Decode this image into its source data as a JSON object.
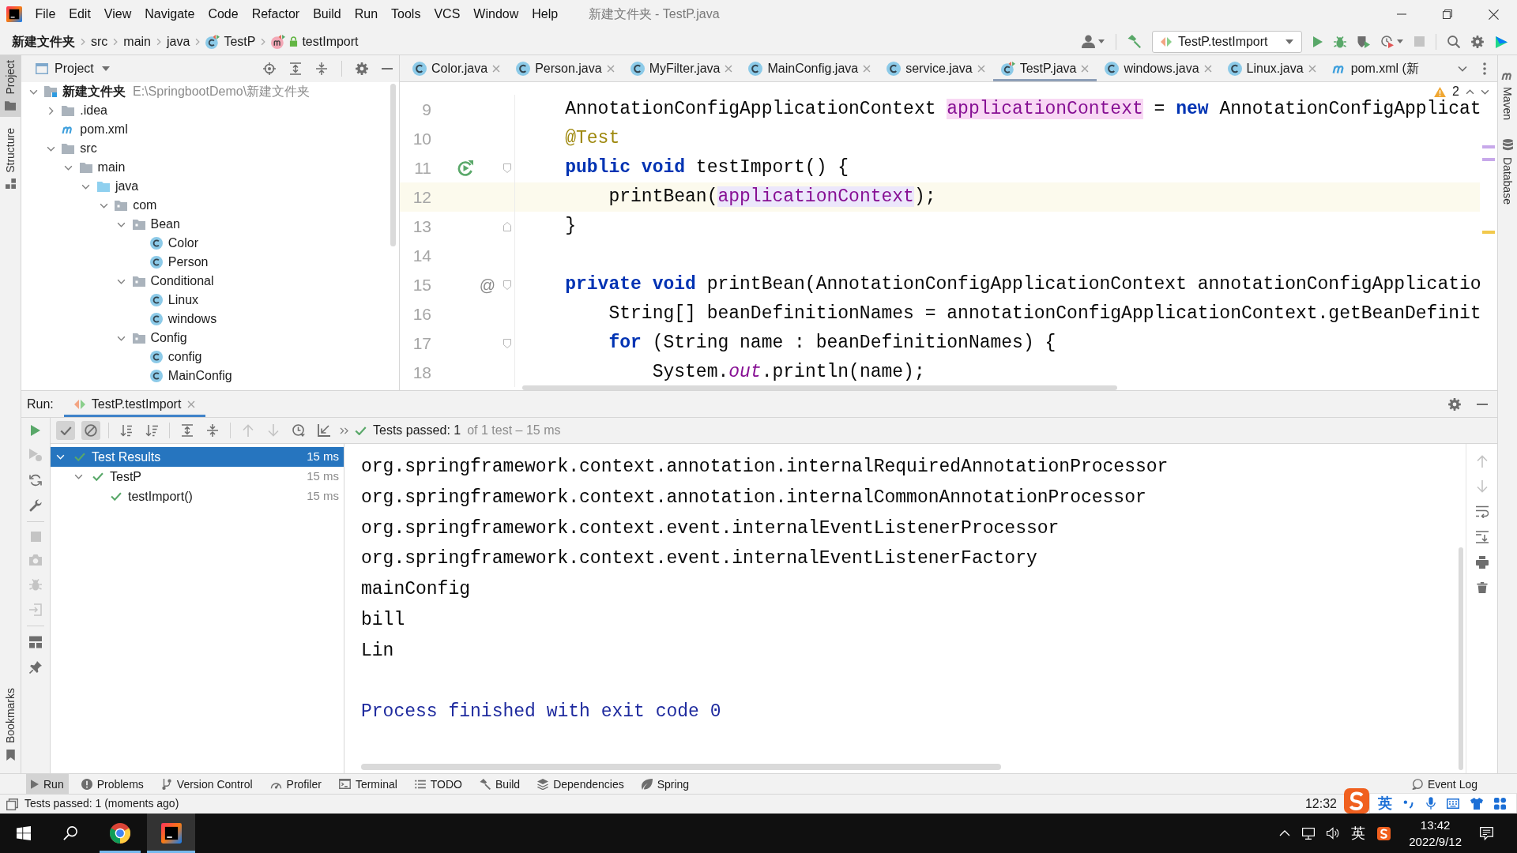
{
  "window": {
    "title": "新建文件夹 - TestP.java",
    "menu": [
      "File",
      "Edit",
      "View",
      "Navigate",
      "Code",
      "Refactor",
      "Build",
      "Run",
      "Tools",
      "VCS",
      "Window",
      "Help"
    ]
  },
  "navigation_bar": {
    "breadcrumbs": [
      {
        "label": "新建文件夹",
        "kind": "project"
      },
      {
        "label": "src",
        "kind": "folder"
      },
      {
        "label": "main",
        "kind": "folder"
      },
      {
        "label": "java",
        "kind": "folder"
      },
      {
        "label": "TestP",
        "kind": "test-class"
      },
      {
        "label": "testImport",
        "kind": "method"
      }
    ],
    "run_configuration": "TestP.testImport",
    "actions": [
      {
        "kind": "run",
        "disabled": false
      },
      {
        "kind": "debug",
        "disabled": false
      },
      {
        "kind": "coverage",
        "disabled": false
      },
      {
        "kind": "profile",
        "disabled": false
      },
      {
        "kind": "stop",
        "disabled": true
      }
    ]
  },
  "left_stripe": {
    "top": [
      {
        "label": "Project",
        "selected": true
      },
      {
        "label": "Structure",
        "selected": false
      }
    ],
    "bottom": [
      {
        "label": "Bookmarks",
        "selected": false
      }
    ]
  },
  "right_stripe": [
    {
      "label": "Maven",
      "selected": false
    },
    {
      "label": "Database",
      "selected": false
    }
  ],
  "project_panel": {
    "title": "Project",
    "tree": [
      {
        "label": "新建文件夹",
        "path": "E:\\SpringbootDemo\\新建文件夹",
        "kind": "module",
        "expanded": true,
        "children": [
          {
            "label": ".idea",
            "kind": "folder",
            "expanded": false
          },
          {
            "label": "pom.xml",
            "kind": "maven"
          },
          {
            "label": "src",
            "kind": "folder",
            "expanded": true,
            "children": [
              {
                "label": "main",
                "kind": "folder",
                "expanded": true,
                "children": [
                  {
                    "label": "java",
                    "kind": "source",
                    "expanded": true,
                    "children": [
                      {
                        "label": "com",
                        "kind": "package",
                        "expanded": true,
                        "children": [
                          {
                            "label": "Bean",
                            "kind": "package",
                            "expanded": true,
                            "children": [
                              {
                                "label": "Color",
                                "kind": "class"
                              },
                              {
                                "label": "Person",
                                "kind": "class"
                              }
                            ]
                          },
                          {
                            "label": "Conditional",
                            "kind": "package",
                            "expanded": true,
                            "children": [
                              {
                                "label": "Linux",
                                "kind": "class"
                              },
                              {
                                "label": "windows",
                                "kind": "class"
                              }
                            ]
                          },
                          {
                            "label": "Config",
                            "kind": "package",
                            "expanded": true,
                            "children": [
                              {
                                "label": "config",
                                "kind": "class"
                              },
                              {
                                "label": "MainConfig",
                                "kind": "class"
                              }
                            ]
                          }
                        ]
                      }
                    ]
                  }
                ]
              }
            ]
          }
        ]
      }
    ]
  },
  "editor": {
    "tabs": [
      {
        "label": "Color.java",
        "kind": "class",
        "selected": false,
        "close_button": true
      },
      {
        "label": "Person.java",
        "kind": "class",
        "selected": false,
        "close_button": true
      },
      {
        "label": "MyFilter.java",
        "kind": "class",
        "selected": false,
        "close_button": true
      },
      {
        "label": "MainConfig.java",
        "kind": "class",
        "selected": false,
        "close_button": true
      },
      {
        "label": "service.java",
        "kind": "class",
        "selected": false,
        "close_button": true
      },
      {
        "label": "TestP.java",
        "kind": "test-class",
        "selected": true,
        "close_button": true
      },
      {
        "label": "windows.java",
        "kind": "class",
        "selected": false,
        "close_button": true
      },
      {
        "label": "Linux.java",
        "kind": "class",
        "selected": false,
        "close_button": true
      },
      {
        "label": "pom.xml (新",
        "kind": "maven",
        "selected": false,
        "close_button": false
      }
    ],
    "inspections": {
      "warnings": "2"
    },
    "lines": [
      {
        "number": "9",
        "current": false,
        "tokens": [
          {
            "text": "    AnnotationConfigApplicationContext ",
            "kind": "plain"
          },
          {
            "text": "applicationContext",
            "kind": "field-write"
          },
          {
            "text": " = ",
            "kind": "plain"
          },
          {
            "text": "new",
            "kind": "keyword"
          },
          {
            "text": " AnnotationConfigApplicat",
            "kind": "plain"
          }
        ]
      },
      {
        "number": "10",
        "current": false,
        "tokens": [
          {
            "text": "    @Test",
            "kind": "annotation"
          }
        ]
      },
      {
        "number": "11",
        "current": false,
        "gutter_icon": {
          "kind": "run"
        },
        "fold": {
          "kind": "start"
        },
        "tokens": [
          {
            "text": "    public void",
            "kind": "keyword"
          },
          {
            "text": " testImport() {",
            "kind": "plain"
          }
        ]
      },
      {
        "number": "12",
        "current": true,
        "tokens": [
          {
            "text": "        printBean(",
            "kind": "plain"
          },
          {
            "text": "applicationContext",
            "kind": "field-read"
          },
          {
            "text": ");",
            "kind": "plain"
          }
        ]
      },
      {
        "number": "13",
        "current": false,
        "fold": {
          "kind": "end"
        },
        "tokens": [
          {
            "text": "    }",
            "kind": "plain"
          }
        ]
      },
      {
        "number": "14",
        "current": false
      },
      {
        "number": "15",
        "current": false,
        "gutter_text": "@",
        "fold": {
          "kind": "start"
        },
        "tokens": [
          {
            "text": "    private void",
            "kind": "keyword"
          },
          {
            "text": " printBean(AnnotationConfigApplicationContext annotationConfigApplicatio",
            "kind": "plain"
          }
        ]
      },
      {
        "number": "16",
        "current": false,
        "tokens": [
          {
            "text": "        String[] beanDefinitionNames = annotationConfigApplicationContext.getBeanDefinit",
            "kind": "plain"
          }
        ]
      },
      {
        "number": "17",
        "current": false,
        "fold": {
          "kind": "start"
        },
        "tokens": [
          {
            "text": "        for",
            "kind": "keyword"
          },
          {
            "text": " (String name : beanDefinitionNames) {",
            "kind": "plain"
          }
        ]
      },
      {
        "number": "18",
        "current": false,
        "tokens": [
          {
            "text": "            System.",
            "kind": "plain"
          },
          {
            "text": "out",
            "kind": "static-field"
          },
          {
            "text": ".println(name);",
            "kind": "plain"
          }
        ]
      }
    ],
    "stripe_marks": [
      {
        "kind": "usage"
      },
      {
        "kind": "usage"
      },
      {
        "kind": "warning"
      }
    ]
  },
  "run_panel": {
    "label": "Run:",
    "tabs": [
      {
        "label": "TestP.testImport",
        "selected": true
      }
    ],
    "side_actions": [
      [
        {
          "kind": "rerun",
          "disabled": false
        },
        {
          "kind": "rerun-failed",
          "disabled": true
        },
        {
          "kind": "auto-test",
          "disabled": false
        },
        {
          "kind": "settings",
          "disabled": false
        }
      ],
      [
        {
          "kind": "stop",
          "disabled": true
        },
        {
          "kind": "snapshot",
          "disabled": true
        },
        {
          "kind": "debug",
          "disabled": true
        },
        {
          "kind": "exit",
          "disabled": true
        }
      ],
      [
        {
          "kind": "layout",
          "disabled": false
        },
        {
          "kind": "pin",
          "disabled": false
        }
      ]
    ],
    "toolbar": [
      [
        {
          "kind": "show-passed",
          "on": true,
          "disabled": false
        },
        {
          "kind": "show-ignored",
          "on": true,
          "disabled": false
        }
      ],
      [
        {
          "kind": "sort-alpha",
          "on": false,
          "disabled": false
        },
        {
          "kind": "sort-duration",
          "on": false,
          "disabled": false
        }
      ],
      [
        {
          "kind": "expand-all",
          "on": false,
          "disabled": false
        },
        {
          "kind": "collapse-all",
          "on": false,
          "disabled": false
        }
      ],
      [
        {
          "kind": "previous",
          "on": false,
          "disabled": true
        },
        {
          "kind": "next",
          "on": false,
          "disabled": true
        },
        {
          "kind": "history",
          "on": false,
          "disabled": false
        },
        {
          "kind": "import",
          "on": false,
          "disabled": false
        }
      ]
    ],
    "summary": {
      "result": "Tests passed: 1",
      "detail": "of 1 test – 15 ms"
    },
    "test_tree": [
      {
        "label": "Test Results",
        "duration": "15 ms",
        "selected": true,
        "expanded": true,
        "children": [
          {
            "label": "TestP",
            "duration": "15 ms",
            "selected": false,
            "expanded": true,
            "children": [
              {
                "label": "testImport()",
                "duration": "15 ms",
                "selected": false
              }
            ]
          }
        ]
      }
    ],
    "console": [
      {
        "text": "org.springframework.context.annotation.internalRequiredAnnotationProcessor",
        "kind": "stdout"
      },
      {
        "text": "org.springframework.context.annotation.internalCommonAnnotationProcessor",
        "kind": "stdout"
      },
      {
        "text": "org.springframework.context.event.internalEventListenerProcessor",
        "kind": "stdout"
      },
      {
        "text": "org.springframework.context.event.internalEventListenerFactory",
        "kind": "stdout"
      },
      {
        "text": "mainConfig",
        "kind": "stdout"
      },
      {
        "text": "bill",
        "kind": "stdout"
      },
      {
        "text": "Lin",
        "kind": "stdout"
      },
      {
        "text": "Process finished with exit code 0",
        "kind": "system"
      }
    ],
    "console_actions": [
      {
        "kind": "up",
        "disabled": true
      },
      {
        "kind": "down",
        "disabled": true
      },
      {
        "kind": "soft-wrap",
        "disabled": false
      },
      {
        "kind": "scroll-end",
        "disabled": false
      },
      {
        "kind": "print",
        "disabled": false
      },
      {
        "kind": "clear",
        "disabled": false
      }
    ]
  },
  "bottom_bar": {
    "tools": [
      {
        "label": "Run",
        "kind": "run",
        "selected": true
      },
      {
        "label": "Problems",
        "kind": "problems",
        "selected": false
      },
      {
        "label": "Version Control",
        "kind": "vcs",
        "selected": false
      },
      {
        "label": "Profiler",
        "kind": "profiler",
        "selected": false
      },
      {
        "label": "Terminal",
        "kind": "terminal",
        "selected": false
      },
      {
        "label": "TODO",
        "kind": "todo",
        "selected": false
      },
      {
        "label": "Build",
        "kind": "build",
        "selected": false
      },
      {
        "label": "Dependencies",
        "kind": "dependencies",
        "selected": false
      },
      {
        "label": "Spring",
        "kind": "spring",
        "selected": false
      }
    ],
    "event_log": "Event Log"
  },
  "status_bar": {
    "message": "Tests passed: 1 (moments ago)",
    "caret_position": "12:32"
  },
  "input_method": {
    "mode": "英"
  },
  "taskbar": {
    "apps": [
      {
        "kind": "browser",
        "selected": false
      },
      {
        "kind": "ide",
        "selected": true
      }
    ],
    "input_language": "英",
    "time": "13:42",
    "date": "2022/9/12"
  }
}
